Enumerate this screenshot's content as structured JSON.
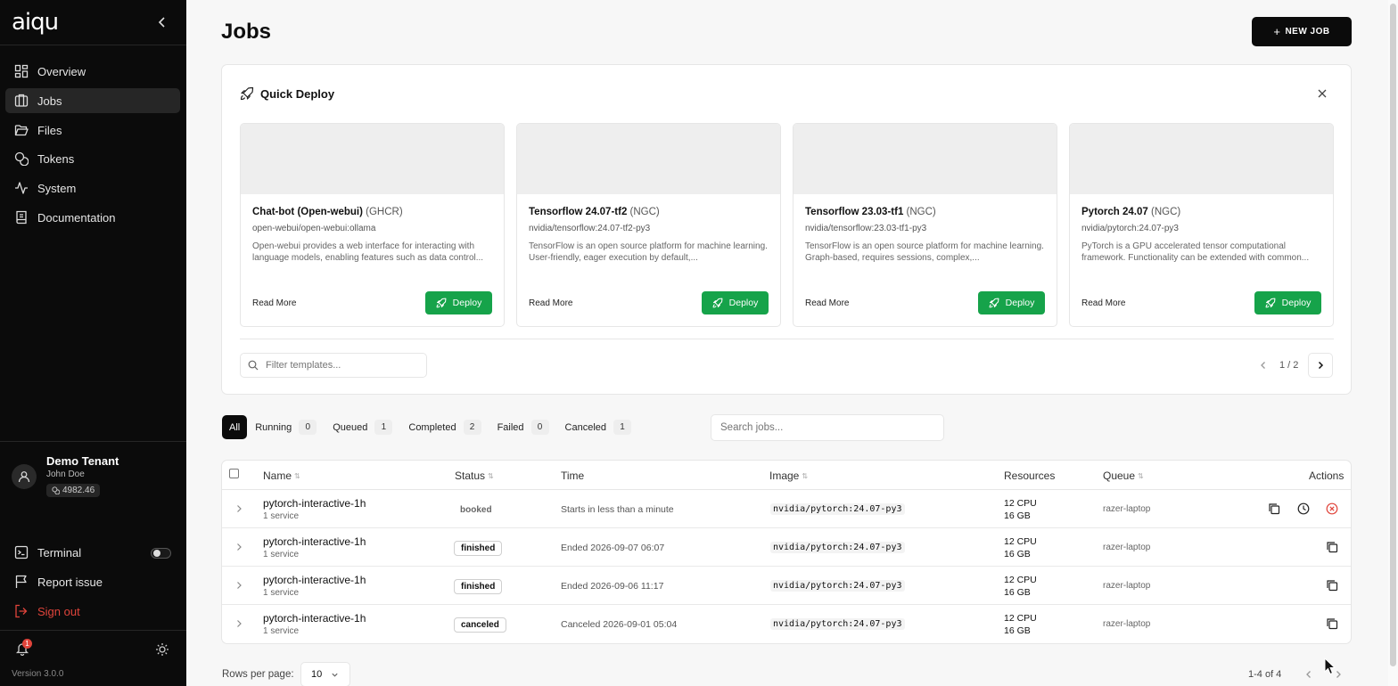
{
  "app": {
    "logo": "aiqu",
    "version": "Version 3.0.0"
  },
  "sidebar": {
    "items": [
      {
        "label": "Overview",
        "icon": "grid-icon"
      },
      {
        "label": "Jobs",
        "icon": "jobs-icon"
      },
      {
        "label": "Files",
        "icon": "folder-icon"
      },
      {
        "label": "Tokens",
        "icon": "coins-icon"
      },
      {
        "label": "System",
        "icon": "activity-icon"
      },
      {
        "label": "Documentation",
        "icon": "book-icon"
      }
    ],
    "user": {
      "tenant": "Demo Tenant",
      "name": "John Doe",
      "credits": "4982.46"
    },
    "bottom": {
      "terminal": "Terminal",
      "report": "Report issue",
      "signout": "Sign out"
    },
    "notifications": "1"
  },
  "header": {
    "title": "Jobs",
    "new_job": "NEW JOB"
  },
  "quick_deploy": {
    "title": "Quick Deploy",
    "cards": [
      {
        "name": "Chat-bot (Open-webui)",
        "source": "(GHCR)",
        "image": "open-webui/open-webui:ollama",
        "desc": "Open-webui provides a web interface for interacting with language models, enabling features such as data control...",
        "read_more": "Read More",
        "deploy": "Deploy"
      },
      {
        "name": "Tensorflow 24.07-tf2",
        "source": "(NGC)",
        "image": "nvidia/tensorflow:24.07-tf2-py3",
        "desc": "TensorFlow is an open source platform for machine learning. User-friendly, eager execution by default,...",
        "read_more": "Read More",
        "deploy": "Deploy"
      },
      {
        "name": "Tensorflow 23.03-tf1",
        "source": "(NGC)",
        "image": "nvidia/tensorflow:23.03-tf1-py3",
        "desc": "TensorFlow is an open source platform for machine learning. Graph-based, requires sessions, complex,...",
        "read_more": "Read More",
        "deploy": "Deploy"
      },
      {
        "name": "Pytorch 24.07",
        "source": "(NGC)",
        "image": "nvidia/pytorch:24.07-py3",
        "desc": "PyTorch is a GPU accelerated tensor computational framework. Functionality can be extended with common...",
        "read_more": "Read More",
        "deploy": "Deploy"
      }
    ],
    "filter_placeholder": "Filter templates...",
    "page": "1 / 2"
  },
  "tabs": [
    {
      "label": "All",
      "count": ""
    },
    {
      "label": "Running",
      "count": "0"
    },
    {
      "label": "Queued",
      "count": "1"
    },
    {
      "label": "Completed",
      "count": "2"
    },
    {
      "label": "Failed",
      "count": "0"
    },
    {
      "label": "Canceled",
      "count": "1"
    }
  ],
  "search_placeholder": "Search jobs...",
  "table": {
    "headers": {
      "name": "Name",
      "status": "Status",
      "time": "Time",
      "image": "Image",
      "resources": "Resources",
      "queue": "Queue",
      "actions": "Actions"
    },
    "rows": [
      {
        "name": "pytorch-interactive-1h",
        "services": "1 service",
        "status": "booked",
        "time": "Starts in less than a minute",
        "image": "nvidia/pytorch:24.07-py3",
        "cpu": "12 CPU",
        "mem": "16 GB",
        "queue": "razer-laptop"
      },
      {
        "name": "pytorch-interactive-1h",
        "services": "1 service",
        "status": "finished",
        "time": "Ended 2026-09-07 06:07",
        "image": "nvidia/pytorch:24.07-py3",
        "cpu": "12 CPU",
        "mem": "16 GB",
        "queue": "razer-laptop"
      },
      {
        "name": "pytorch-interactive-1h",
        "services": "1 service",
        "status": "finished",
        "time": "Ended 2026-09-06 11:17",
        "image": "nvidia/pytorch:24.07-py3",
        "cpu": "12 CPU",
        "mem": "16 GB",
        "queue": "razer-laptop"
      },
      {
        "name": "pytorch-interactive-1h",
        "services": "1 service",
        "status": "canceled",
        "time": "Canceled 2026-09-01 05:04",
        "image": "nvidia/pytorch:24.07-py3",
        "cpu": "12 CPU",
        "mem": "16 GB",
        "queue": "razer-laptop"
      }
    ]
  },
  "footer": {
    "rows_per_page": "Rows per page:",
    "rows_value": "10",
    "range": "1-4 of 4"
  },
  "colors": {
    "accent": "#0b0b0b",
    "deploy": "#16a34a",
    "danger": "#e0443b"
  }
}
